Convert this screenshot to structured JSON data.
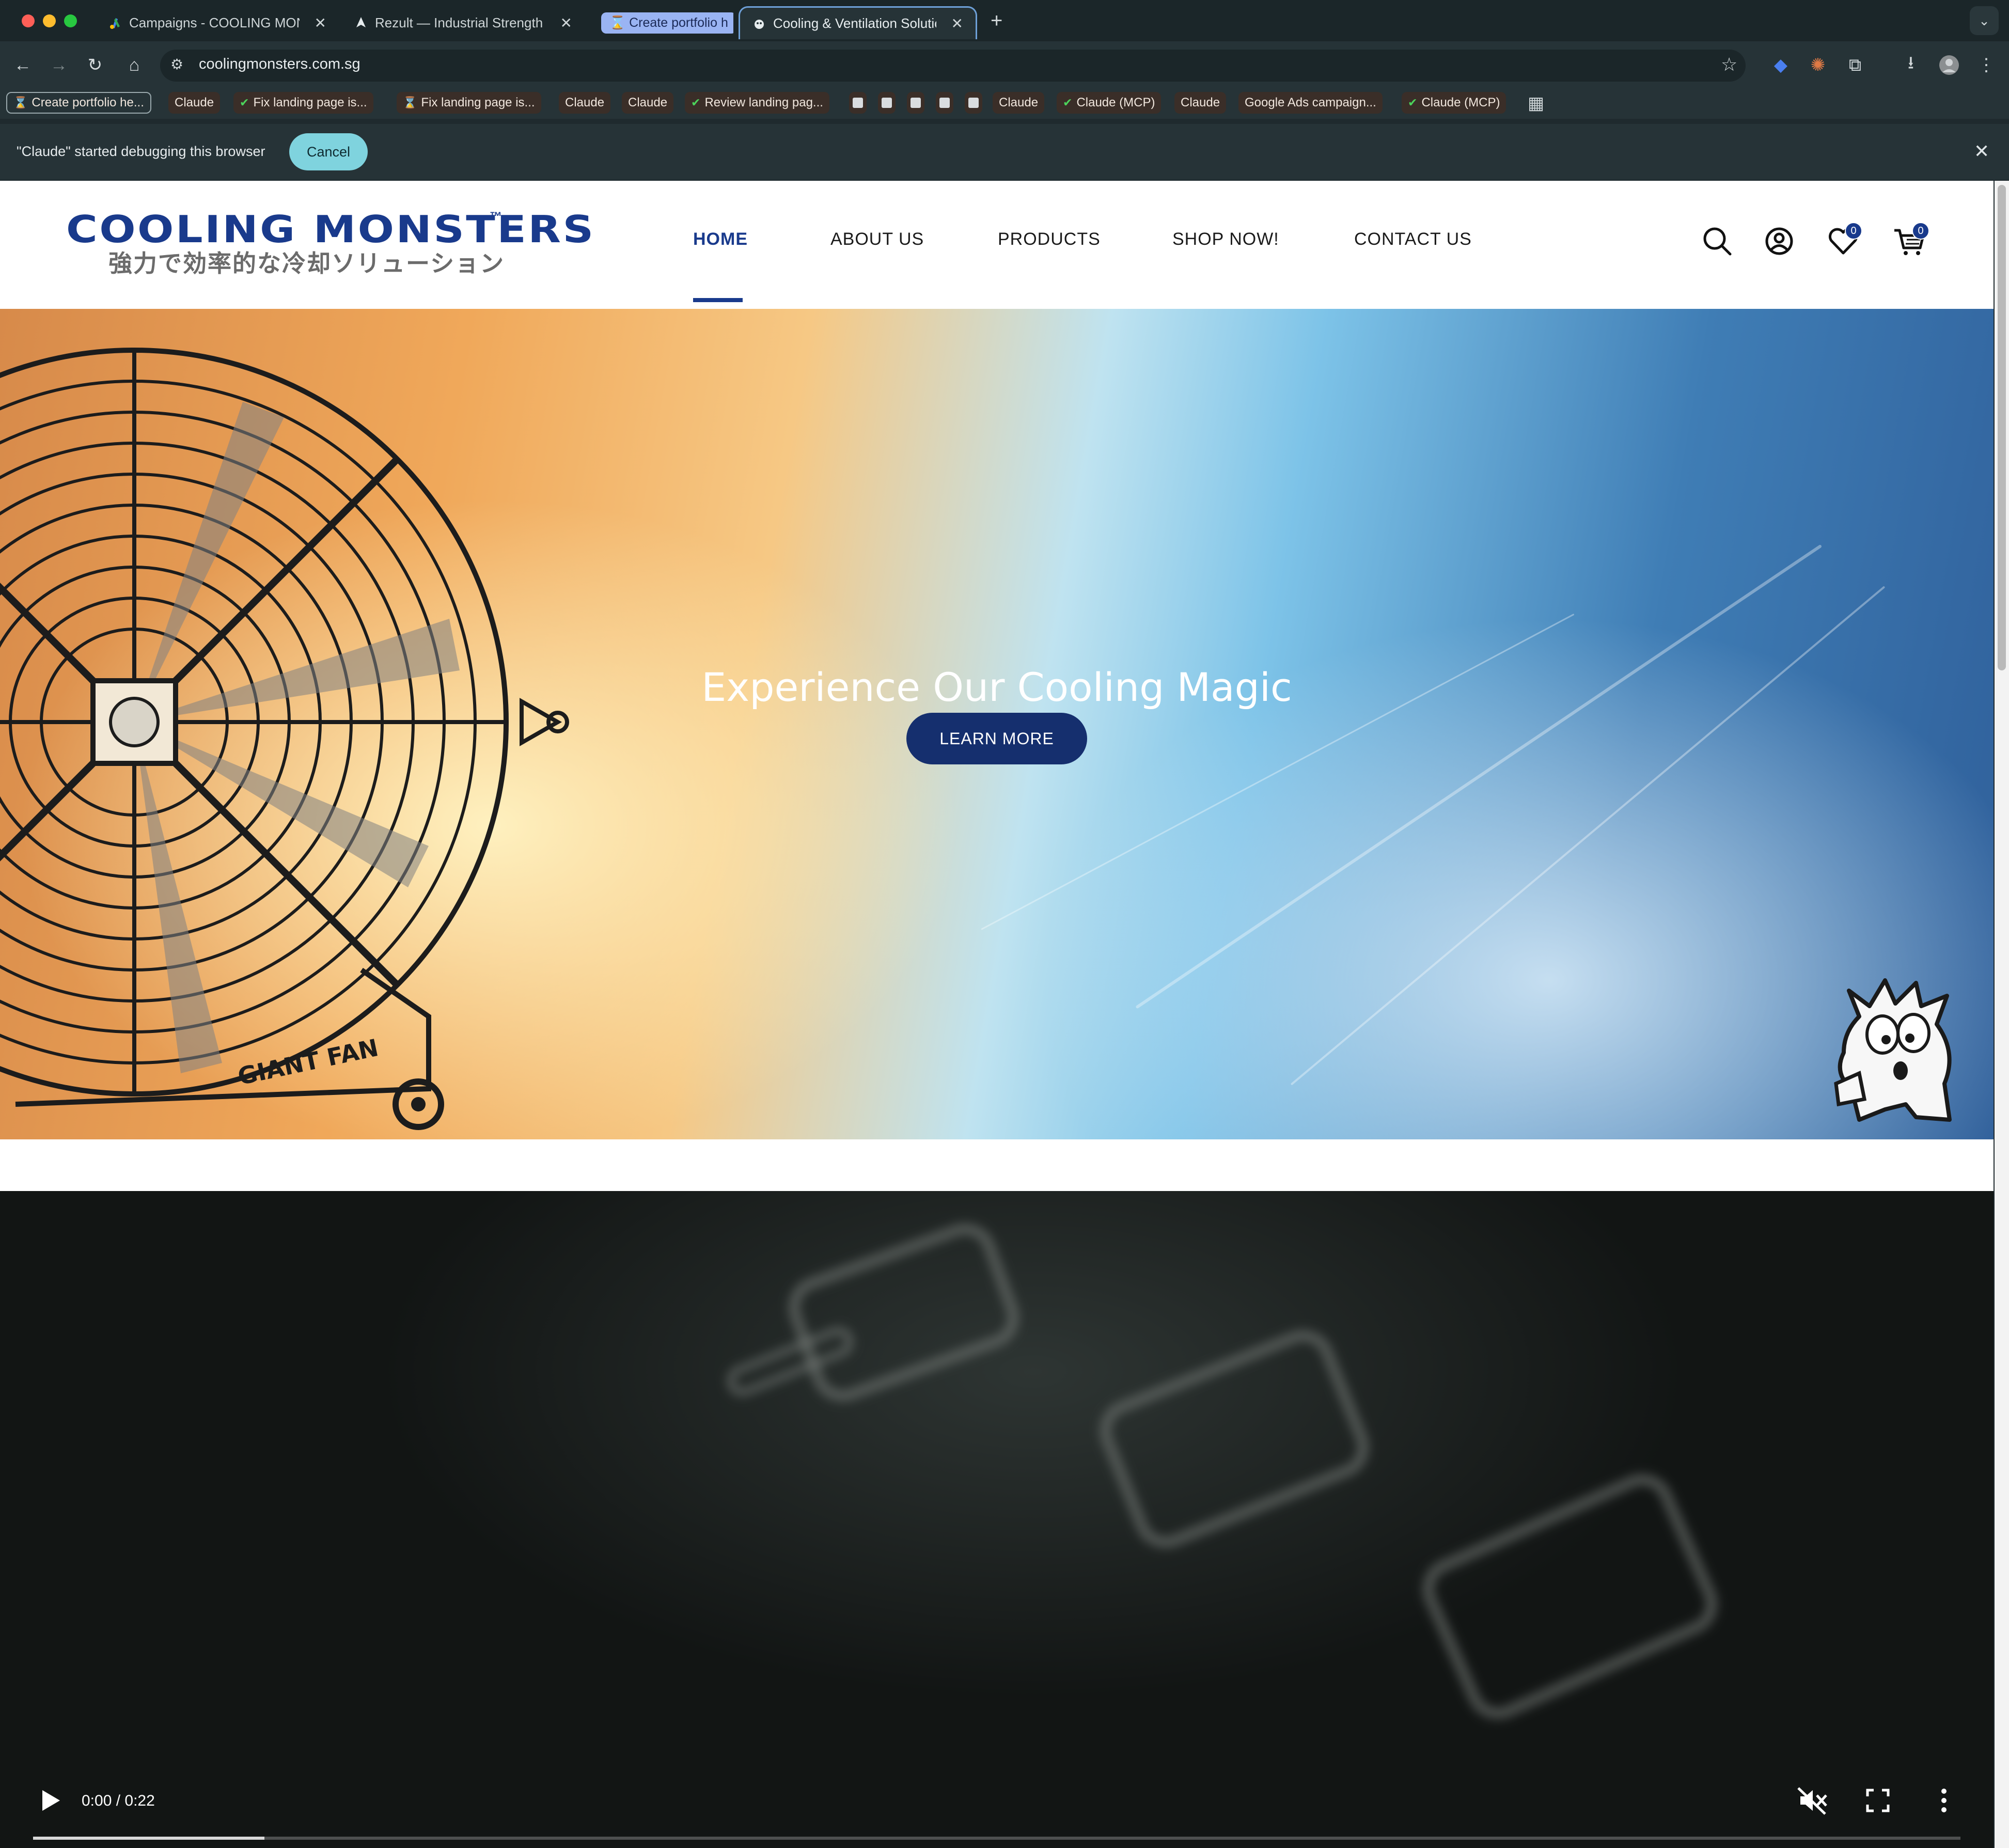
{
  "browser": {
    "tabs": [
      {
        "title": "Campaigns - COOLING MON",
        "icon": "google-ads-icon"
      },
      {
        "title": "Rezult — Industrial Strength D",
        "icon": "rezult-icon"
      },
      {
        "title": "Create portfolio h",
        "icon": "hourglass-icon",
        "grouped": true
      },
      {
        "title": "Cooling & Ventilation Solution",
        "icon": "site-icon",
        "active": true
      }
    ],
    "url": "coolingmonsters.com.sg",
    "bookmarks": [
      {
        "label": "Create portfolio he...",
        "icon": "hourglass-icon"
      },
      {
        "label": "Claude"
      },
      {
        "label": "Fix landing page is...",
        "icon": "check-icon"
      },
      {
        "label": "Fix landing page is...",
        "icon": "hourglass-icon"
      },
      {
        "label": "Claude"
      },
      {
        "label": "Claude"
      },
      {
        "label": "Review landing pag...",
        "icon": "check-icon"
      },
      {
        "label": "Claude"
      },
      {
        "label": "Claude (MCP)",
        "icon": "check-icon"
      },
      {
        "label": "Claude"
      },
      {
        "label": "Google Ads campaign..."
      },
      {
        "label": "Claude (MCP)",
        "icon": "check-icon"
      }
    ],
    "infobar": {
      "message": "\"Claude\" started debugging this browser",
      "cancel_label": "Cancel"
    }
  },
  "site": {
    "logo": {
      "name": "COOLING MONSTERS",
      "tm": "™",
      "tagline": "強力で効率的な冷却ソリューション"
    },
    "nav": [
      {
        "label": "HOME",
        "active": true
      },
      {
        "label": "ABOUT US"
      },
      {
        "label": "PRODUCTS"
      },
      {
        "label": "SHOP NOW!"
      },
      {
        "label": "CONTACT US"
      }
    ],
    "wishlist_count": "0",
    "cart_count": "0",
    "hero": {
      "title": "Experience Our Cooling Magic",
      "cta": "LEARN MORE",
      "fan_label": "GIANT FAN"
    },
    "video": {
      "time": "0:00 / 0:22",
      "progress": 0.12
    }
  },
  "colors": {
    "brand_blue": "#193a8c",
    "cta_blue": "#152f6e",
    "cancel_teal": "#7fd3de"
  }
}
